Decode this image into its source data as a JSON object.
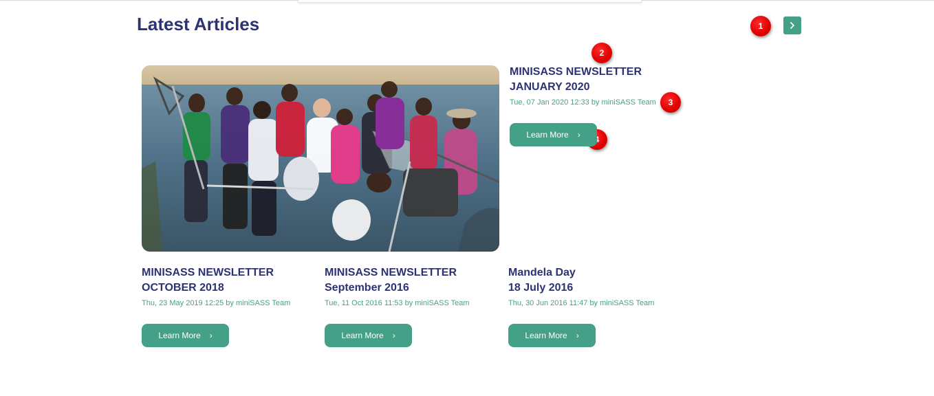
{
  "section": {
    "title": "Latest Articles"
  },
  "nav": {
    "next_icon": "chevron-right-icon"
  },
  "markers": [
    "1",
    "2",
    "3",
    "4"
  ],
  "featured": {
    "title_line1": "MINISASS NEWSLETTER",
    "title_line2": "JANUARY 2020",
    "meta": "Tue, 07 Jan 2020 12:33 by miniSASS Team",
    "button_label": "Learn More"
  },
  "articles": [
    {
      "title_line1": "MINISASS NEWSLETTER",
      "title_line2": "OCTOBER 2018",
      "meta": "Thu, 23 May 2019 12:25 by miniSASS Team",
      "button_label": "Learn More"
    },
    {
      "title_line1": "MINISASS NEWSLETTER",
      "title_line2": "September 2016",
      "meta": "Tue, 11 Oct 2016 11:53 by miniSASS Team",
      "button_label": "Learn More"
    },
    {
      "title_line1": "Mandela Day",
      "title_line2": "18 July 2016",
      "meta": "Thu, 30 Jun 2016 11:47 by miniSASS Team",
      "button_label": "Learn More"
    }
  ],
  "colors": {
    "title": "#2c3272",
    "accent": "#45a088",
    "marker": "#e00000"
  }
}
